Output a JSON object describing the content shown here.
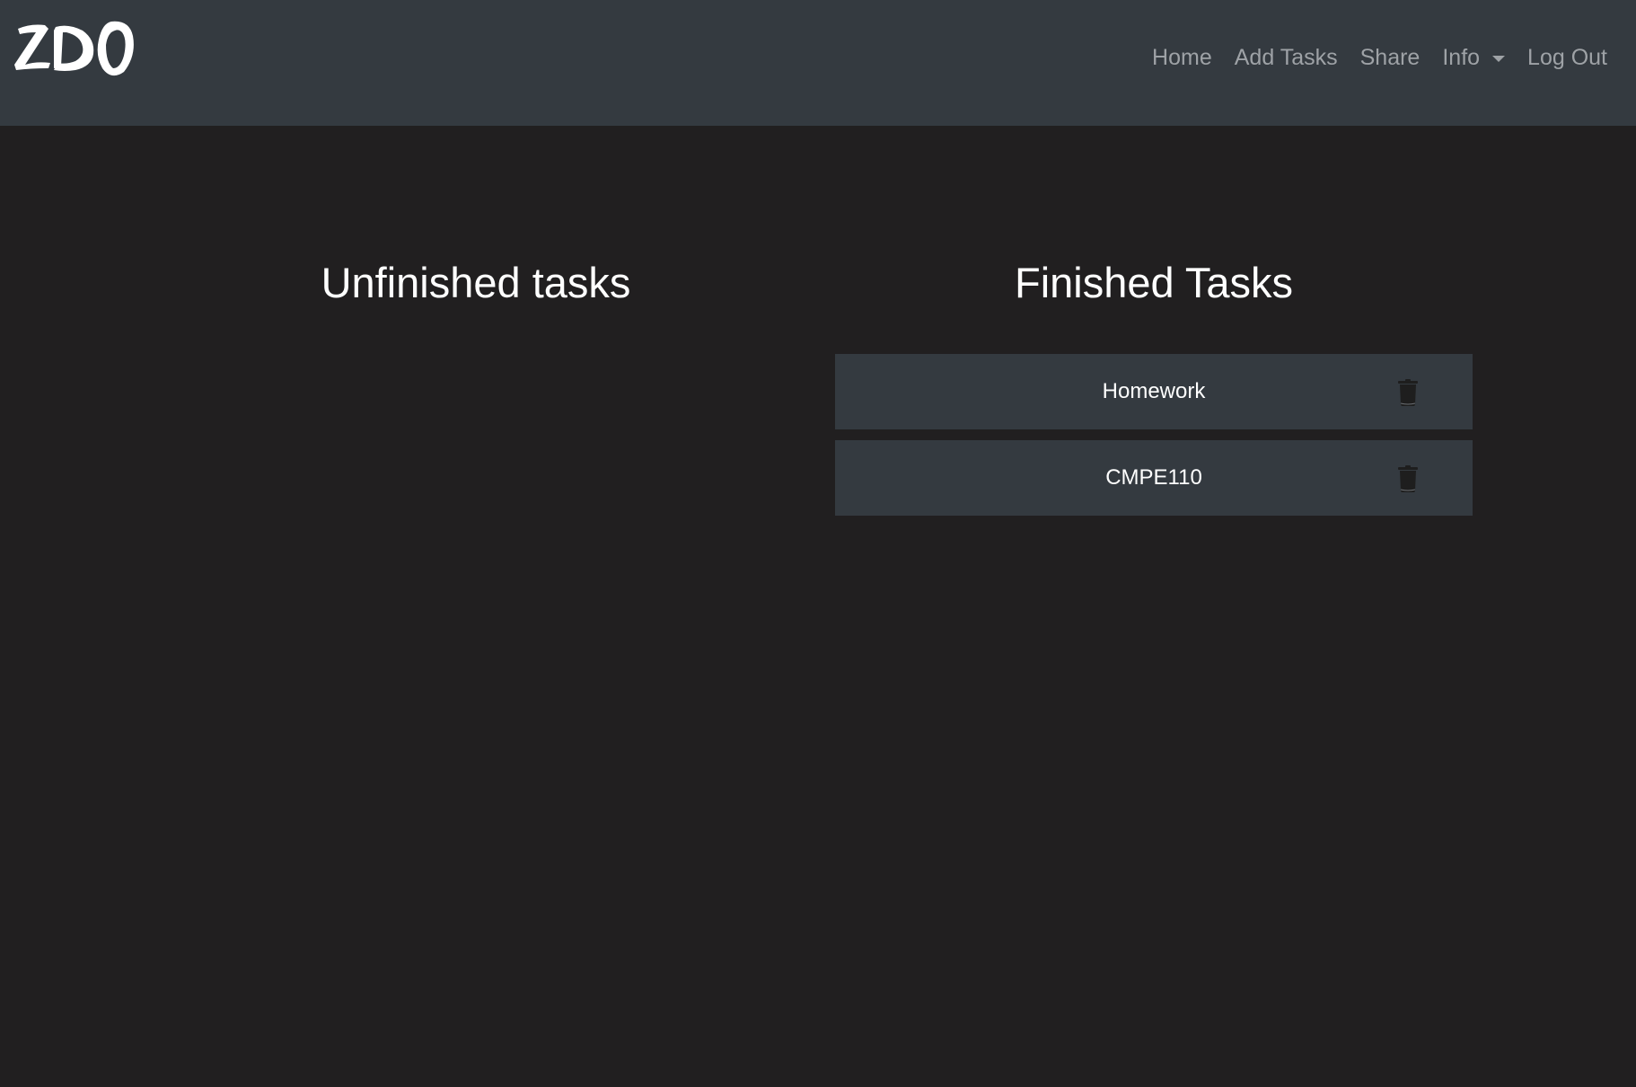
{
  "navbar": {
    "brand_text": "ZDO",
    "links": {
      "home": "Home",
      "add_tasks": "Add Tasks",
      "share": "Share",
      "info": "Info",
      "log_out": "Log Out"
    }
  },
  "columns": {
    "unfinished": {
      "title": "Unfinished tasks",
      "tasks": []
    },
    "finished": {
      "title": "Finished Tasks",
      "tasks": [
        {
          "name": "Homework",
          "icon": "trash-icon"
        },
        {
          "name": "CMPE110",
          "icon": "trash-icon"
        }
      ]
    }
  },
  "colors": {
    "navbar_bg": "#343a40",
    "page_bg": "#211f20",
    "nav_link": "#9ea2a6",
    "card_bg": "#343a40",
    "text": "#ffffff"
  }
}
